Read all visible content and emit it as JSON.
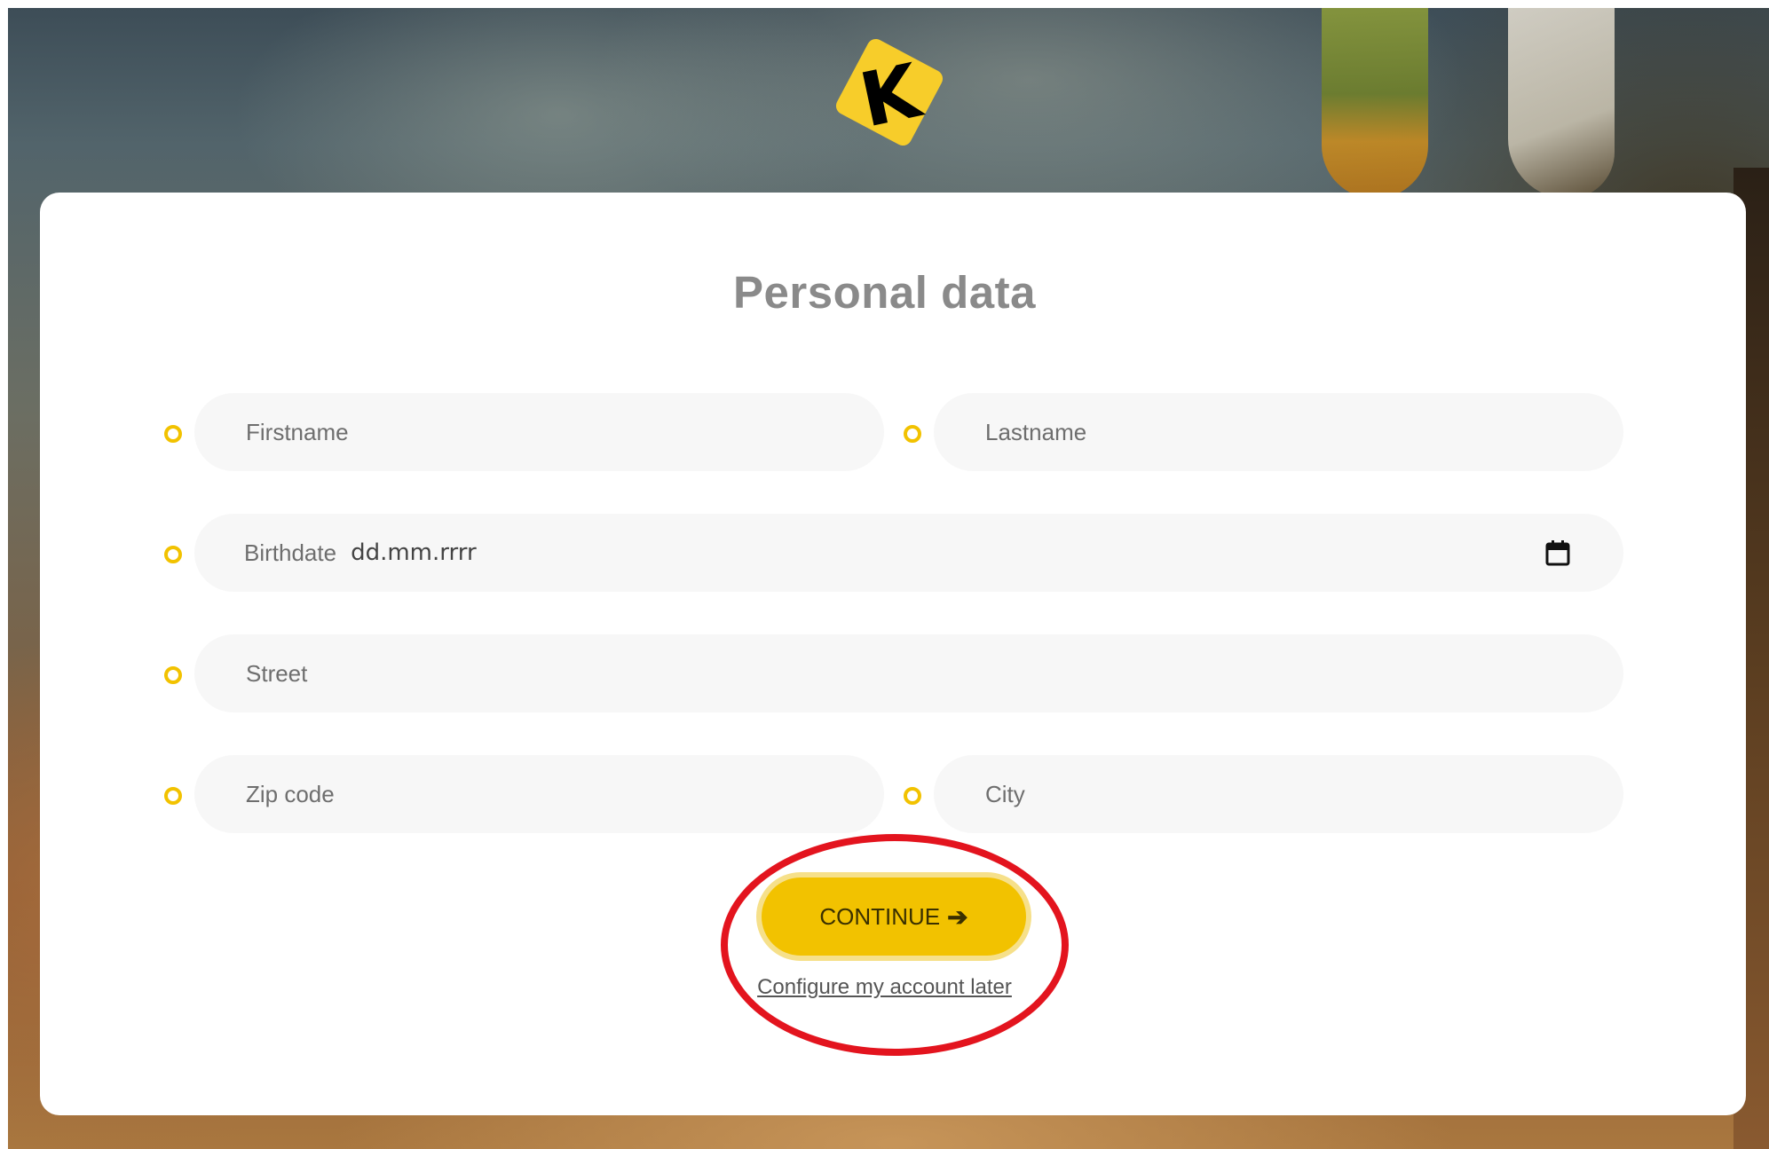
{
  "page": {
    "title": "Personal data"
  },
  "logo": {
    "letter": "K",
    "color": "#f7cd2a"
  },
  "form": {
    "firstname": {
      "placeholder": "Firstname"
    },
    "lastname": {
      "placeholder": "Lastname"
    },
    "birthdate": {
      "label": "Birthdate",
      "value": "dd.mm.rrrr"
    },
    "street": {
      "placeholder": "Street"
    },
    "zip": {
      "placeholder": "Zip code"
    },
    "city": {
      "placeholder": "City"
    }
  },
  "actions": {
    "continue_label": "CONTINUE",
    "continue_icon": "arrow-right-icon",
    "later_label": "Configure my account later"
  },
  "colors": {
    "accent": "#f2c200",
    "annotation": "#e3141e",
    "title": "#8a8a8a"
  }
}
